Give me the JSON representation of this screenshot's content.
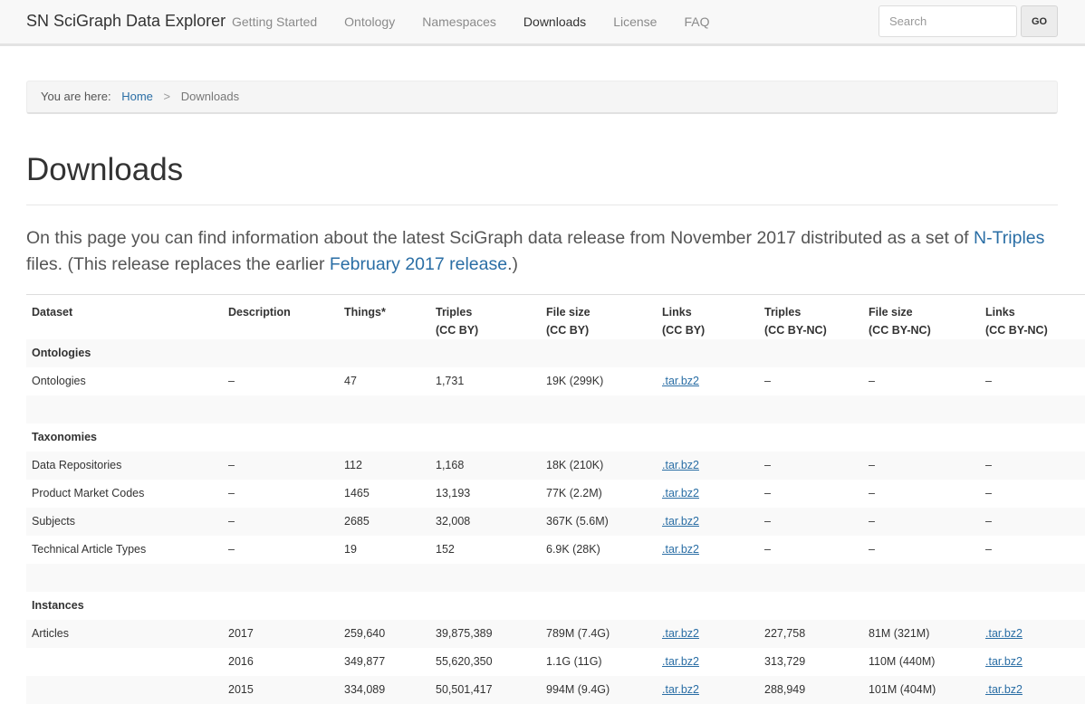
{
  "navbar": {
    "brand": "SN SciGraph Data Explorer",
    "links": [
      "Getting Started",
      "Ontology",
      "Namespaces",
      "Downloads",
      "License",
      "FAQ"
    ],
    "active": "Downloads",
    "search_placeholder": "Search",
    "go_label": "GO"
  },
  "breadcrumb": {
    "prefix": "You are here:",
    "home": "Home",
    "separator": ">",
    "current": "Downloads"
  },
  "page": {
    "title": "Downloads",
    "intro": {
      "part1": "On this page you can find information about the latest SciGraph data release from November 2017 distributed as a set of ",
      "link1": "N-Triples",
      "part2": " files. (This release replaces the earlier ",
      "link2": "February 2017 release",
      "part3": ".)"
    }
  },
  "table": {
    "headers": [
      [
        "Dataset"
      ],
      [
        "Description"
      ],
      [
        "Things*"
      ],
      [
        "Triples",
        "(CC BY)"
      ],
      [
        "File size",
        "(CC BY)"
      ],
      [
        "Links",
        "(CC BY)"
      ],
      [
        "Triples",
        "(CC BY-NC)"
      ],
      [
        "File size",
        "(CC BY-NC)"
      ],
      [
        "Links",
        "(CC BY-NC)"
      ]
    ],
    "rows": [
      {
        "type": "group",
        "label": "Ontologies"
      },
      {
        "type": "data",
        "cells": [
          "Ontologies",
          "–",
          "47",
          "1,731",
          "19K (299K)",
          ".tar.bz2",
          "–",
          "–",
          "–"
        ]
      },
      {
        "type": "spacer"
      },
      {
        "type": "group",
        "label": "Taxonomies"
      },
      {
        "type": "data",
        "cells": [
          "Data Repositories",
          "–",
          "112",
          "1,168",
          "18K (210K)",
          ".tar.bz2",
          "–",
          "–",
          "–"
        ]
      },
      {
        "type": "data",
        "cells": [
          "Product Market Codes",
          "–",
          "1465",
          "13,193",
          "77K (2.2M)",
          ".tar.bz2",
          "–",
          "–",
          "–"
        ]
      },
      {
        "type": "data",
        "cells": [
          "Subjects",
          "–",
          "2685",
          "32,008",
          "367K (5.6M)",
          ".tar.bz2",
          "–",
          "–",
          "–"
        ]
      },
      {
        "type": "data",
        "cells": [
          "Technical Article Types",
          "–",
          "19",
          "152",
          "6.9K (28K)",
          ".tar.bz2",
          "–",
          "–",
          "–"
        ]
      },
      {
        "type": "spacer"
      },
      {
        "type": "group",
        "label": "Instances"
      },
      {
        "type": "data",
        "cells": [
          "Articles",
          "2017",
          "259,640",
          "39,875,389",
          "789M (7.4G)",
          ".tar.bz2",
          "227,758",
          "81M (321M)",
          ".tar.bz2"
        ]
      },
      {
        "type": "data",
        "cells": [
          "",
          "2016",
          "349,877",
          "55,620,350",
          "1.1G (11G)",
          ".tar.bz2",
          "313,729",
          "110M (440M)",
          ".tar.bz2"
        ]
      },
      {
        "type": "data",
        "cells": [
          "",
          "2015",
          "334,089",
          "50,501,417",
          "994M (9.4G)",
          ".tar.bz2",
          "288,949",
          "101M (404M)",
          ".tar.bz2"
        ]
      }
    ]
  }
}
